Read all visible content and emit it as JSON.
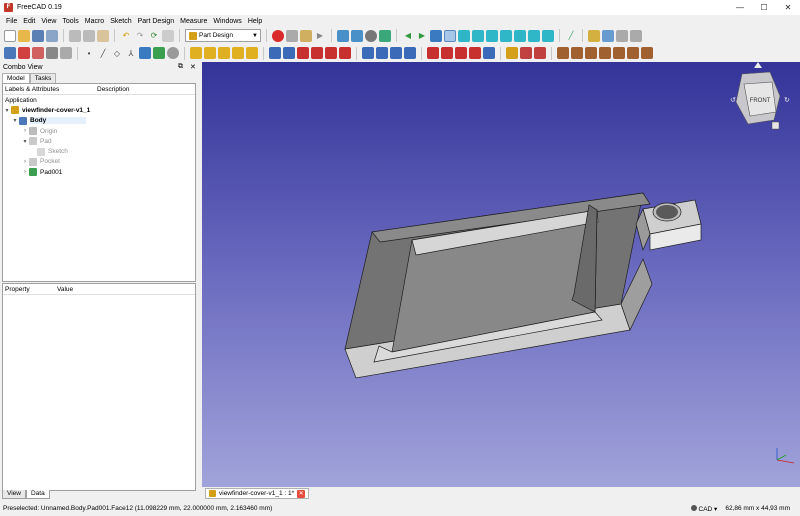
{
  "window": {
    "title": "FreeCAD 0.19",
    "minimize": "—",
    "maximize": "☐",
    "close": "✕"
  },
  "menu": [
    "File",
    "Edit",
    "View",
    "Tools",
    "Macro",
    "Sketch",
    "Part Design",
    "Measure",
    "Windows",
    "Help"
  ],
  "toolbar": {
    "workbench": "Part Design"
  },
  "combo_view": {
    "title": "Combo View",
    "tabs": [
      "Model",
      "Tasks"
    ],
    "columns": [
      "Labels & Attributes",
      "Description"
    ],
    "root": "Application",
    "tree": [
      {
        "label": "viewfinder-cover-v1_1"
      },
      {
        "label": "Body"
      },
      {
        "label": "Origin"
      },
      {
        "label": "Pad"
      },
      {
        "label": "Sketch"
      },
      {
        "label": "Pocket"
      },
      {
        "label": "Pad001"
      }
    ],
    "property_columns": [
      "Property",
      "Value"
    ],
    "bottom_tabs": [
      "View",
      "Data"
    ]
  },
  "navcube": {
    "face": "FRONT"
  },
  "document_tab": {
    "label": "viewfinder-cover-v1_1 : 1*"
  },
  "status": {
    "message": "Preselected: Unnamed.Body.Pad001.Face12 (11.098229 mm, 22.000000 mm, 2.163460 mm)",
    "nav_style": "CAD",
    "dimensions": "62,86 mm x 44,93 mm"
  },
  "colors": {
    "viewport_top": "#333399",
    "viewport_bottom": "#a1a3da",
    "model": "#7f7f7f"
  }
}
